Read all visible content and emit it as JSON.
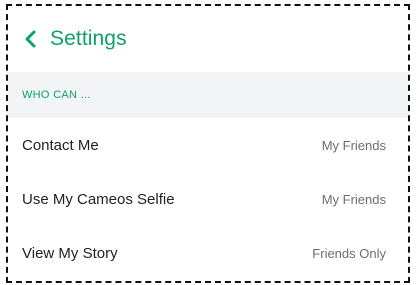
{
  "header": {
    "back_icon": "chevron-left-icon",
    "title": "Settings",
    "accent_color": "#0fa06b"
  },
  "section": {
    "label": "WHO CAN ..."
  },
  "rows": [
    {
      "label": "Contact Me",
      "value": "My Friends"
    },
    {
      "label": "Use My Cameos Selfie",
      "value": "My Friends"
    },
    {
      "label": "View My Story",
      "value": "Friends Only"
    }
  ]
}
